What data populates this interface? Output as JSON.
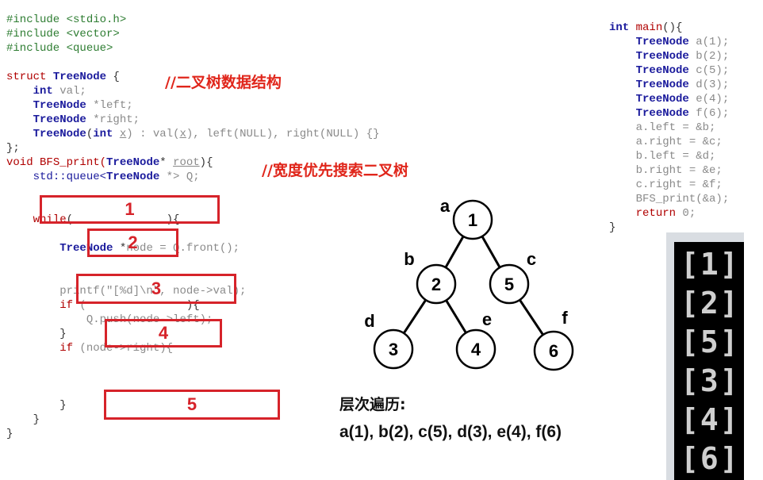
{
  "code_left": {
    "lines": [
      [
        {
          "t": "#include <stdio.h>",
          "c": "gr"
        }
      ],
      [
        {
          "t": "#include <vector>",
          "c": "gr"
        }
      ],
      [
        {
          "t": "#include <queue>",
          "c": "gr"
        }
      ],
      [],
      [
        {
          "t": "struct ",
          "c": "rd"
        },
        {
          "t": "TreeNode",
          "c": "ty"
        },
        {
          "t": " {",
          "c": ""
        }
      ],
      [
        {
          "t": "    ",
          "c": ""
        },
        {
          "t": "int",
          "c": "kw"
        },
        {
          "t": " val;",
          "c": "gy"
        }
      ],
      [
        {
          "t": "    ",
          "c": ""
        },
        {
          "t": "TreeNode",
          "c": "ty"
        },
        {
          "t": " *left;",
          "c": "gy"
        }
      ],
      [
        {
          "t": "    ",
          "c": ""
        },
        {
          "t": "TreeNode",
          "c": "ty"
        },
        {
          "t": " *right;",
          "c": "gy"
        }
      ],
      [
        {
          "t": "    ",
          "c": ""
        },
        {
          "t": "TreeNode",
          "c": "ty"
        },
        {
          "t": "(",
          "c": ""
        },
        {
          "t": "int",
          "c": "kw"
        },
        {
          "t": " ",
          "c": ""
        },
        {
          "t": "x",
          "c": "ul"
        },
        {
          "t": ") : val(",
          "c": "gy"
        },
        {
          "t": "x",
          "c": "ul"
        },
        {
          "t": "), left(NULL), right(NULL) {}",
          "c": "gy"
        }
      ],
      [
        {
          "t": "};",
          "c": ""
        }
      ],
      [
        {
          "t": "void ",
          "c": "rd"
        },
        {
          "t": "BFS_print(",
          "c": "rd"
        },
        {
          "t": "TreeNode",
          "c": "ty"
        },
        {
          "t": "* ",
          "c": ""
        },
        {
          "t": "root",
          "c": "ul"
        },
        {
          "t": "){",
          "c": ""
        }
      ],
      [
        {
          "t": "    ",
          "c": ""
        },
        {
          "t": "std::queue<",
          "c": "bl"
        },
        {
          "t": "TreeNode",
          "c": "ty"
        },
        {
          "t": " *> Q;",
          "c": "gy"
        }
      ],
      [],
      [],
      [
        {
          "t": "    ",
          "c": ""
        },
        {
          "t": "while",
          "c": "rd"
        },
        {
          "t": "(",
          "c": ""
        },
        {
          "t": "              ",
          "c": ""
        },
        {
          "t": "){",
          "c": ""
        }
      ],
      [],
      [
        {
          "t": "        ",
          "c": ""
        },
        {
          "t": "TreeNode",
          "c": "ty"
        },
        {
          "t": " *",
          "c": ""
        },
        {
          "t": "node = Q.",
          "c": "gy"
        },
        {
          "t": "front();",
          "c": "gy"
        }
      ],
      [],
      [],
      [
        {
          "t": "        ",
          "c": ""
        },
        {
          "t": "printf(\"[%d]\\n\", node->val);",
          "c": "gy"
        }
      ],
      [
        {
          "t": "        ",
          "c": ""
        },
        {
          "t": "if",
          "c": "rd"
        },
        {
          "t": " (",
          "c": "gy"
        },
        {
          "t": "               ",
          "c": ""
        },
        {
          "t": "){",
          "c": ""
        }
      ],
      [
        {
          "t": "            ",
          "c": ""
        },
        {
          "t": "Q.push(node->left);",
          "c": "gy"
        }
      ],
      [
        {
          "t": "        }",
          "c": ""
        }
      ],
      [
        {
          "t": "        ",
          "c": ""
        },
        {
          "t": "if",
          "c": "rd"
        },
        {
          "t": " (node->right){",
          "c": "gy"
        }
      ],
      [],
      [],
      [],
      [
        {
          "t": "        }",
          "c": ""
        }
      ],
      [
        {
          "t": "    }",
          "c": ""
        }
      ],
      [
        {
          "t": "}",
          "c": ""
        }
      ]
    ]
  },
  "code_right": {
    "lines": [
      [
        {
          "t": "int",
          "c": "kw"
        },
        {
          "t": " ",
          "c": ""
        },
        {
          "t": "main",
          "c": "rd"
        },
        {
          "t": "(){",
          "c": ""
        }
      ],
      [
        {
          "t": "    ",
          "c": ""
        },
        {
          "t": "TreeNode",
          "c": "ty"
        },
        {
          "t": " a(1);",
          "c": "gy"
        }
      ],
      [
        {
          "t": "    ",
          "c": ""
        },
        {
          "t": "TreeNode",
          "c": "ty"
        },
        {
          "t": " b(2);",
          "c": "gy"
        }
      ],
      [
        {
          "t": "    ",
          "c": ""
        },
        {
          "t": "TreeNode",
          "c": "ty"
        },
        {
          "t": " c(5);",
          "c": "gy"
        }
      ],
      [
        {
          "t": "    ",
          "c": ""
        },
        {
          "t": "TreeNode",
          "c": "ty"
        },
        {
          "t": " d(3);",
          "c": "gy"
        }
      ],
      [
        {
          "t": "    ",
          "c": ""
        },
        {
          "t": "TreeNode",
          "c": "ty"
        },
        {
          "t": " e(4);",
          "c": "gy"
        }
      ],
      [
        {
          "t": "    ",
          "c": ""
        },
        {
          "t": "TreeNode",
          "c": "ty"
        },
        {
          "t": " f(6);",
          "c": "gy"
        }
      ],
      [
        {
          "t": "    a.left = &b;",
          "c": "gy"
        }
      ],
      [
        {
          "t": "    a.right = &c;",
          "c": "gy"
        }
      ],
      [
        {
          "t": "    b.left = &d;",
          "c": "gy"
        }
      ],
      [
        {
          "t": "    b.right = &e;",
          "c": "gy"
        }
      ],
      [
        {
          "t": "    c.right = &f;",
          "c": "gy"
        }
      ],
      [
        {
          "t": "    BFS_print(&a);",
          "c": "gy"
        }
      ],
      [
        {
          "t": "    ",
          "c": ""
        },
        {
          "t": "return",
          "c": "rd"
        },
        {
          "t": " 0;",
          "c": "gy"
        }
      ],
      [
        {
          "t": "}",
          "c": ""
        }
      ]
    ]
  },
  "comments": {
    "struct": "//二叉树数据结构",
    "bfs": "//宽度优先搜索二叉树"
  },
  "blanks": [
    "1",
    "2",
    "3",
    "4",
    "5"
  ],
  "tree": {
    "nodes": [
      {
        "id": "a",
        "label": "a",
        "value": "1"
      },
      {
        "id": "b",
        "label": "b",
        "value": "2"
      },
      {
        "id": "c",
        "label": "c",
        "value": "5"
      },
      {
        "id": "d",
        "label": "d",
        "value": "3"
      },
      {
        "id": "e",
        "label": "e",
        "value": "4"
      },
      {
        "id": "f",
        "label": "f",
        "value": "6"
      }
    ],
    "edges": [
      [
        "a",
        "b"
      ],
      [
        "a",
        "c"
      ],
      [
        "b",
        "d"
      ],
      [
        "b",
        "e"
      ],
      [
        "c",
        "f"
      ]
    ]
  },
  "traversal": {
    "title": "层次遍历:",
    "order": "a(1), b(2), c(5), d(3), e(4), f(6)"
  },
  "console": {
    "lines": [
      "[1]",
      "[2]",
      "[5]",
      "[3]",
      "[4]",
      "[6]"
    ]
  }
}
